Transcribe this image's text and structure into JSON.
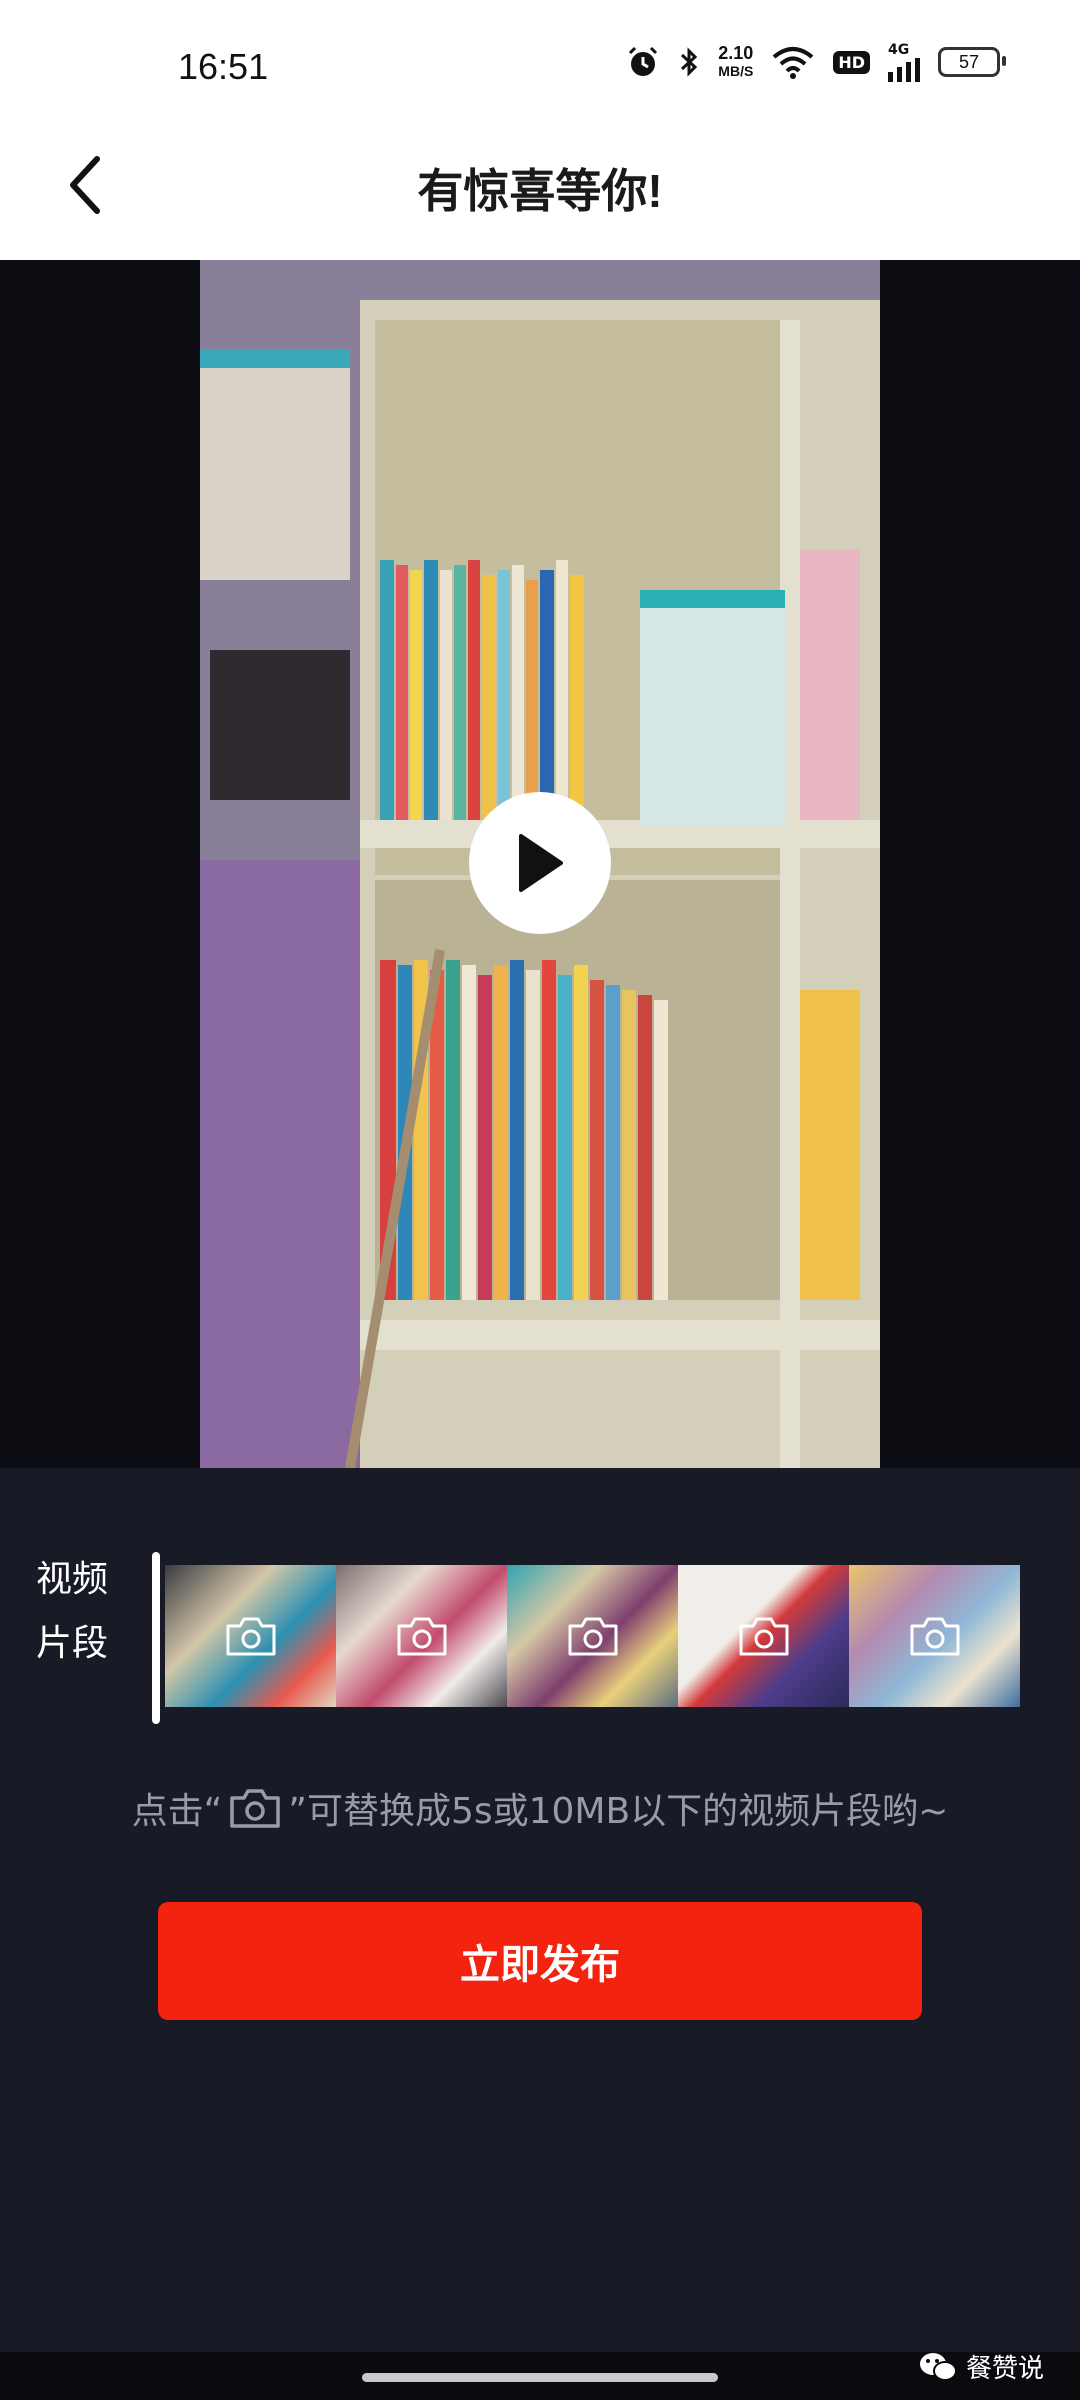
{
  "status_bar": {
    "time": "16:51",
    "net_speed_value": "2.10",
    "net_speed_unit": "MB/S",
    "hd": "HD",
    "network": "4G",
    "battery": "57",
    "icons": [
      "alarm-icon",
      "bluetooth-icon",
      "wifi-icon",
      "signal-icon",
      "battery-icon"
    ]
  },
  "header": {
    "title": "有惊喜等你!",
    "back_icon": "chevron-left-icon"
  },
  "video": {
    "play_icon": "play-icon"
  },
  "segments": {
    "label_line1": "视频",
    "label_line2": "片段",
    "thumbnails": [
      {
        "icon": "camera-icon"
      },
      {
        "icon": "camera-icon"
      },
      {
        "icon": "camera-icon"
      },
      {
        "icon": "camera-icon"
      },
      {
        "icon": "camera-icon"
      }
    ]
  },
  "hint": {
    "prefix": "点击“",
    "suffix": "”可替换成5s或10MB以下的视频片段哟~",
    "icon": "camera-icon"
  },
  "actions": {
    "publish_label": "立即发布"
  },
  "watermark": {
    "text": "餐赞说",
    "icon": "wechat-icon"
  },
  "colors": {
    "accent": "#f4230f",
    "background": "#181a26"
  }
}
